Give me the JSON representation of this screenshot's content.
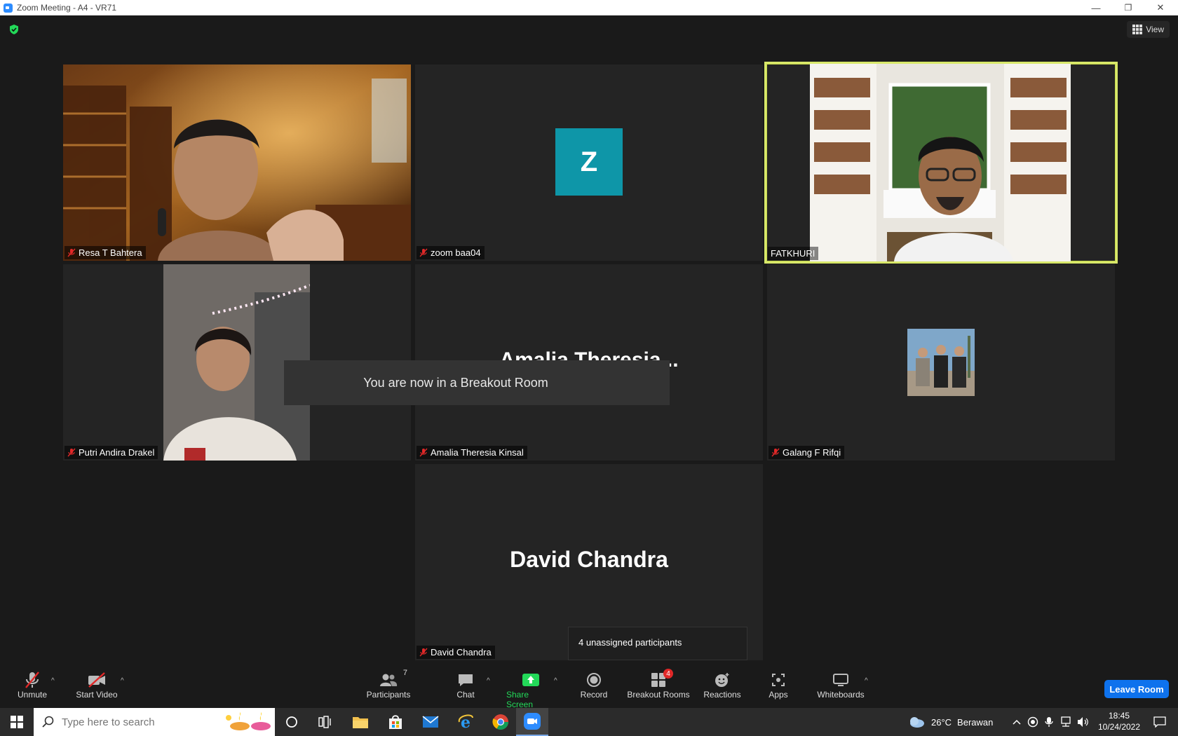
{
  "window": {
    "title": "Zoom Meeting - A4 - VR71",
    "minimize": "—",
    "restore": "❐",
    "close": "✕"
  },
  "header": {
    "view_label": "View"
  },
  "tiles": [
    {
      "name": "Resa T Bahtera",
      "muted": true
    },
    {
      "name": "zoom baa04",
      "muted": true,
      "avatar_letter": "Z"
    },
    {
      "name": "FATKHURI",
      "muted": false,
      "active_speaker": true
    },
    {
      "name": "Putri Andira Drakel",
      "muted": true
    },
    {
      "name": "Amalia Theresia Kinsal",
      "muted": true,
      "display_name": "Amalia  Theresia..."
    },
    {
      "name": "Galang F Rifqi",
      "muted": true
    },
    {
      "name": "David Chandra",
      "muted": true,
      "display_name": "David Chandra"
    }
  ],
  "notifications": {
    "breakout_toast": "You are now in a Breakout Room",
    "unassigned_tooltip": "4 unassigned participants"
  },
  "toolbar": {
    "unmute": "Unmute",
    "start_video": "Start Video",
    "participants": "Participants",
    "participants_count": "7",
    "chat": "Chat",
    "share_screen": "Share Screen",
    "record": "Record",
    "breakout_rooms": "Breakout Rooms",
    "breakout_badge": "4",
    "reactions": "Reactions",
    "apps": "Apps",
    "whiteboards": "Whiteboards",
    "leave_room": "Leave Room",
    "caret": "^"
  },
  "colors": {
    "share_green": "#23d959",
    "speaker_border": "#d8e86a",
    "leave_blue": "#0e72ed",
    "avatar_teal": "#0e96a8"
  },
  "taskbar": {
    "search_placeholder": "Type here to search",
    "weather_temp": "26°C",
    "weather_desc": "Berawan",
    "time": "18:45",
    "date": "10/24/2022"
  }
}
